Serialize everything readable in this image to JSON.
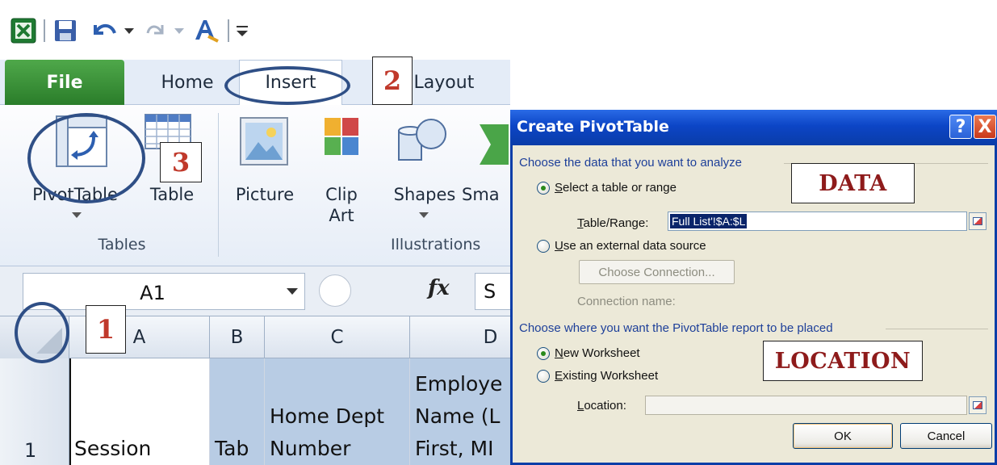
{
  "quick_access": {
    "icons": [
      "excel-logo-icon",
      "save-icon",
      "undo-icon",
      "redo-icon",
      "format-painter-icon",
      "customize-qat-icon"
    ]
  },
  "tabs": {
    "file": "File",
    "home": "Home",
    "insert": "Insert",
    "page_layout_partial": "e Layout"
  },
  "ribbon": {
    "pivottable": "PivotTable",
    "table": "Table",
    "picture": "Picture",
    "clip_art": "Clip\nArt",
    "shapes": "Shapes",
    "smartart_partial": "Sma",
    "tables_group": "Tables",
    "illustrations_group": "Illustrations"
  },
  "formula_bar": {
    "name_box": "A1",
    "fx": "fx",
    "formula_partial": "S"
  },
  "columns": [
    "A",
    "B",
    "C",
    "D"
  ],
  "row1": {
    "number": "1",
    "a": "Session",
    "b": "Tab",
    "c_line1": "Home Dept",
    "c_line2": "Number",
    "d_line1": "Employe",
    "d_line2": "Name (L",
    "d_line3": "First, MI"
  },
  "annotations": {
    "step1": "1",
    "step2": "2",
    "step3": "3",
    "data": "DATA",
    "location": "LOCATION"
  },
  "dialog": {
    "title": "Create PivotTable",
    "help": "?",
    "close": "X",
    "section_data": "Choose the data that you want to analyze",
    "opt_select_range_u": "S",
    "opt_select_range_rest": "elect a table or range",
    "table_range_u": "T",
    "table_range_rest": "able/Range:",
    "table_range_value": "Full List'!$A:$L",
    "opt_external_u": "U",
    "opt_external_rest": "se an external data source",
    "choose_connection": "Choose Connection...",
    "connection_name": "Connection name:",
    "section_location": "Choose where you want the PivotTable report to be placed",
    "opt_new_ws_u": "N",
    "opt_new_ws_rest": "ew Worksheet",
    "opt_existing_ws_u": "E",
    "opt_existing_ws_rest": "xisting Worksheet",
    "location_u": "L",
    "location_rest": "ocation:",
    "ok": "OK",
    "cancel": "Cancel"
  },
  "colors": {
    "file_tab": "#3a8f36",
    "title_bar": "#0c45c6",
    "annotation_oval": "#2f4f86",
    "annotation_text": "#c0392b",
    "selected_column": "#b8cce4"
  }
}
